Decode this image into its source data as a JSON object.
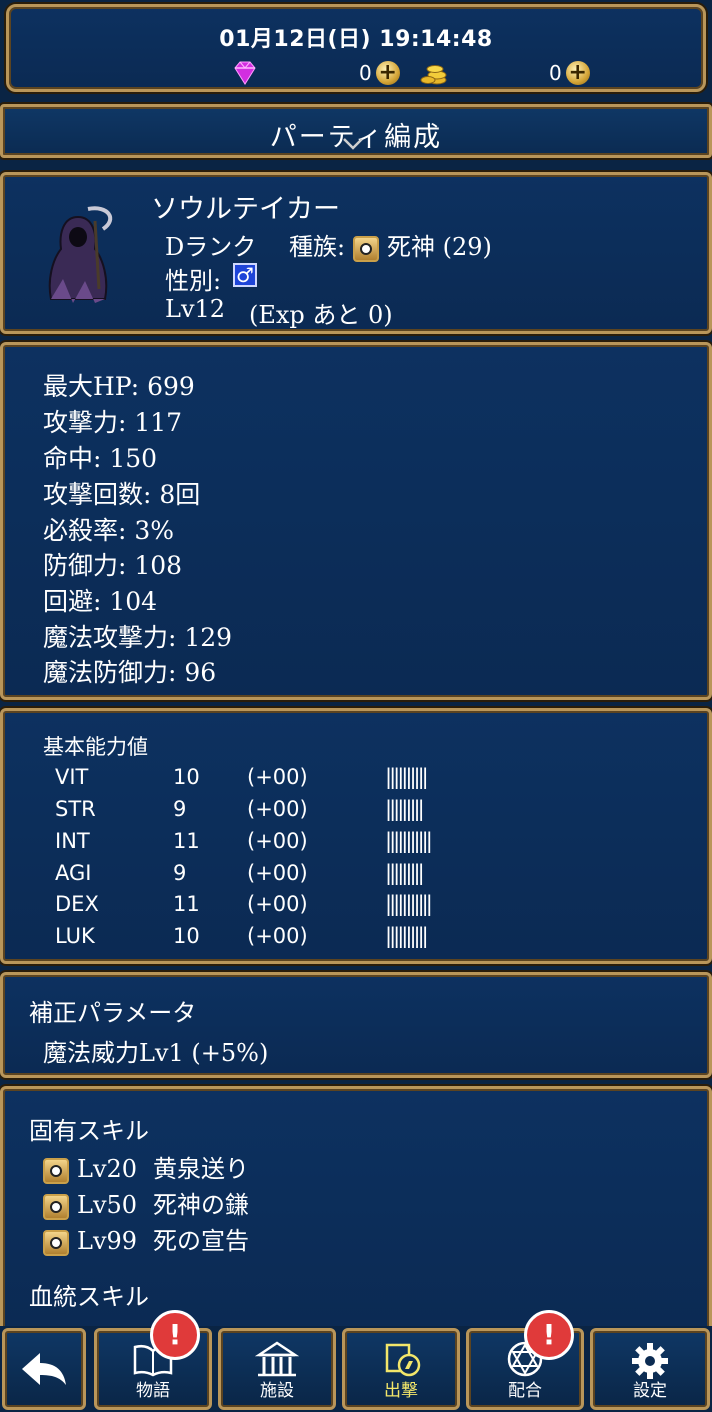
{
  "header": {
    "datetime": "01月12日(日) 19:14:48",
    "gems": "0",
    "coins": "0",
    "gem_icon": "gem-icon",
    "coin_icon": "coin-stack-icon"
  },
  "title": "パーティ編成",
  "unit": {
    "name": "ソウルテイカー",
    "rank": "Dランク",
    "race_label": "種族:",
    "race": "死神 (29)",
    "gender_label": "性別:",
    "gender": "♂",
    "level": "Lv12",
    "exp": "(Exp あと 0)"
  },
  "stats": [
    "最大HP: 699",
    "攻撃力: 117",
    "命中: 150",
    "攻撃回数: 8回",
    "必殺率: 3%",
    "防御力: 108",
    "回避: 104",
    "魔法攻撃力: 129",
    "魔法防御力: 96"
  ],
  "basic": {
    "heading": "基本能力値",
    "rows": [
      {
        "name": "VIT",
        "value": "10",
        "bonus": "(+00)",
        "bar": "||||||||||"
      },
      {
        "name": "STR",
        "value": "9",
        "bonus": "(+00)",
        "bar": "|||||||||"
      },
      {
        "name": "INT",
        "value": "11",
        "bonus": "(+00)",
        "bar": "|||||||||||"
      },
      {
        "name": "AGI",
        "value": "9",
        "bonus": "(+00)",
        "bar": "|||||||||"
      },
      {
        "name": "DEX",
        "value": "11",
        "bonus": "(+00)",
        "bar": "|||||||||||"
      },
      {
        "name": "LUK",
        "value": "10",
        "bonus": "(+00)",
        "bar": "||||||||||"
      }
    ]
  },
  "modifier": {
    "heading": "補正パラメータ",
    "value": "魔法威力Lv1 (+5%)"
  },
  "skills": {
    "heading": "固有スキル",
    "items": [
      {
        "level": "Lv20",
        "name": "黄泉送り"
      },
      {
        "level": "Lv50",
        "name": "死神の鎌"
      },
      {
        "level": "Lv99",
        "name": "死の宣告"
      }
    ],
    "bloodline_heading": "血統スキル"
  },
  "nav": {
    "story": "物語",
    "facility": "施設",
    "sortie": "出撃",
    "fusion": "配合",
    "settings": "設定",
    "badge": "!"
  }
}
